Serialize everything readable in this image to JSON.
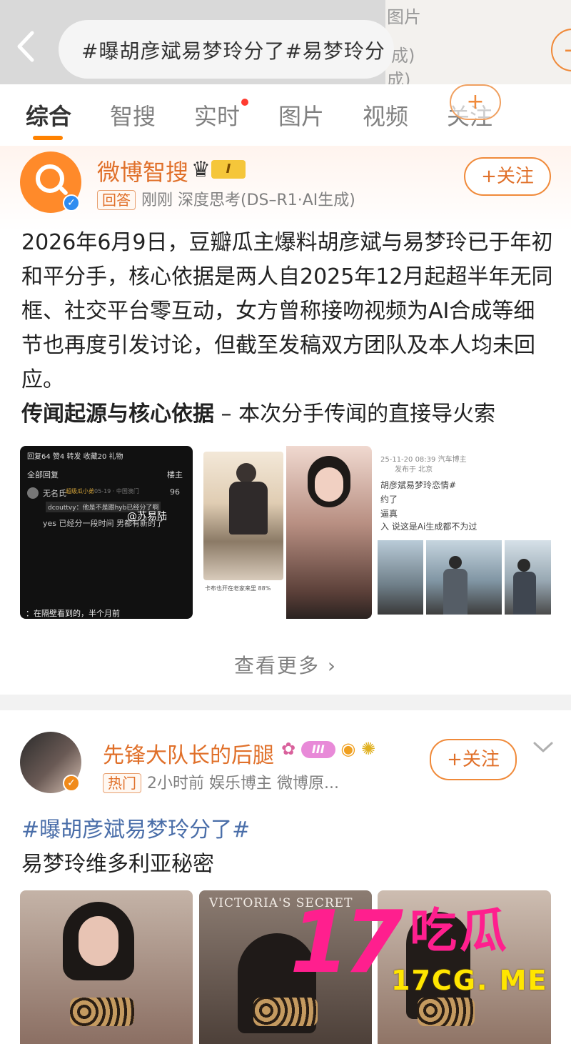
{
  "header": {
    "back_icon": "chevron-left-icon",
    "search_query": "#曝胡彦斌易梦玲分了#易梦玲分",
    "ghost_lines": [
      "图片",
      "成)",
      "成)"
    ],
    "ghost_plus": "+"
  },
  "tabs": [
    {
      "label": "综合",
      "active": true
    },
    {
      "label": "智搜"
    },
    {
      "label": "实时",
      "dot": true
    },
    {
      "label": "图片"
    },
    {
      "label": "视频"
    },
    {
      "label": "关注"
    }
  ],
  "tab_plus": "+",
  "card1": {
    "author": "微博智搜",
    "level_badge": "I",
    "tag": "回答",
    "meta": "刚刚 深度思考(DS–R1·AI生成)",
    "follow_label": "+关注",
    "body": "2026年6月9日，豆瓣瓜主爆料胡彦斌与易梦玲已于年初和平分手，核心依据是两人自2025年12月起超半年无同框、社交平台零互动，女方曾称接吻视频为AI合成等细节也再度引发讨论，但截至发稿双方团队及本人均未回应。",
    "subheading_bold": "传闻起源与核心依据",
    "subheading_rest": " – 本次分手传闻的直接导火索",
    "images": [
      {
        "tabs": "回复64  赞4  转发  收藏20  礼物",
        "all_reply": "全部回复",
        "host": "楼主",
        "user": "无名氏",
        "badge": "超级瓜小弟",
        "date": "05-19 · 中国澳门",
        "likes": "96",
        "reply1": "dcouttvy：他是不是跟hyb已经分了啊",
        "reply2": "yes 已经分一段时间 男都有新的了",
        "at": "@苏易陆",
        "footer": "：在隔壁看到的，半个月前"
      },
      {
        "caption": "卡布也开在老家来里 88%"
      },
      {
        "line1": "25-11-20 08:39 汽车博主",
        "line2": "发布于 北京",
        "line3": "胡彦斌易梦玲恋情#",
        "line4": "约了",
        "line5": "逼真",
        "line6": "入 说这是Ai生成都不为过"
      }
    ],
    "more_label": "查看更多  ›"
  },
  "card2": {
    "author": "先锋大队长的后腿",
    "level_badge": "III",
    "badge_icons": [
      "pink-mushroom-icon",
      "fish-icon",
      "sunflower-icon"
    ],
    "tag": "热门",
    "meta": "2小时前 娱乐博主 微博原...",
    "follow_label": "+关注",
    "hashtag": "#曝胡彦斌易梦玲分了#",
    "body": "易梦玲维多利亚秘密",
    "image_text": "VICTORIA'S SECRET"
  },
  "watermark": {
    "number": "17",
    "name": "吃瓜",
    "url": "17CG. ME"
  },
  "colors": {
    "accent": "#ff8200",
    "author": "#e0702a",
    "hashtag": "#4a6ea9",
    "watermark_pink": "#ff1f8e",
    "watermark_yellow": "#ffe600"
  }
}
